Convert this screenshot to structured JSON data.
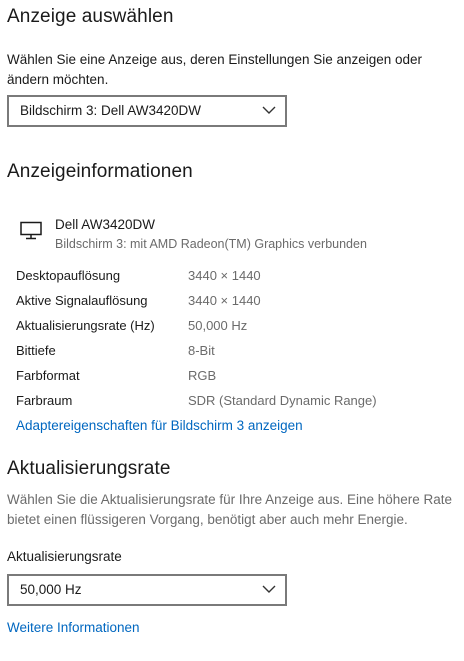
{
  "select_display": {
    "heading": "Anzeige auswählen",
    "description": "Wählen Sie eine Anzeige aus, deren Einstellungen Sie anzeigen oder ändern möchten.",
    "dropdown_value": "Bildschirm 3: Dell AW3420DW"
  },
  "display_info": {
    "heading": "Anzeigeinformationen",
    "icon": "monitor-icon",
    "monitor_name": "Dell AW3420DW",
    "monitor_subtitle": "Bildschirm 3: mit AMD Radeon(TM) Graphics verbunden",
    "rows": [
      {
        "label": "Desktopauflösung",
        "value": "3440 × 1440"
      },
      {
        "label": "Aktive Signalauflösung",
        "value": "3440 × 1440"
      },
      {
        "label": "Aktualisierungsrate (Hz)",
        "value": "50,000 Hz"
      },
      {
        "label": "Bittiefe",
        "value": "8-Bit"
      },
      {
        "label": "Farbformat",
        "value": "RGB"
      },
      {
        "label": "Farbraum",
        "value": "SDR (Standard Dynamic Range)"
      }
    ],
    "adapter_link": "Adaptereigenschaften für Bildschirm 3 anzeigen"
  },
  "refresh_rate": {
    "heading": "Aktualisierungsrate",
    "description": "Wählen Sie die Aktualisierungsrate für Ihre Anzeige aus. Eine höhere Rate bietet einen flüssigeren Vorgang, benötigt aber auch mehr Energie.",
    "field_label": "Aktualisierungsrate",
    "dropdown_value": "50,000 Hz",
    "more_info_link": "Weitere Informationen"
  }
}
